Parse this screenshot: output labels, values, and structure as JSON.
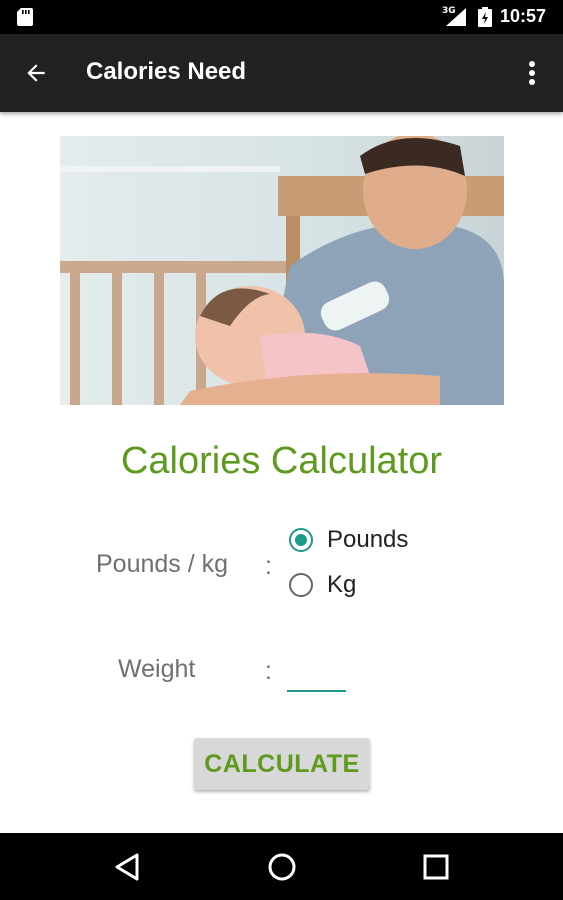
{
  "status_bar": {
    "network": "3G",
    "time": "10:57",
    "icons": [
      "sd-card-icon",
      "signal-icon",
      "battery-icon"
    ]
  },
  "app_bar": {
    "title": "Calories Need",
    "back_icon": "arrow-left-icon",
    "menu_icon": "more-vert-icon"
  },
  "hero": {
    "image": "photo-father-feeding-baby-bottle"
  },
  "calculator": {
    "heading": "Calories Calculator",
    "unit_label": "Pounds / kg",
    "unit_colon": ":",
    "unit_options": [
      {
        "label": "Pounds",
        "checked": true
      },
      {
        "label": "Kg",
        "checked": false
      }
    ],
    "weight_label": "Weight",
    "weight_colon": ":",
    "weight_value": "",
    "weight_placeholder": "",
    "button_label": "CALCULATE"
  },
  "colors": {
    "accent_green": "#5d9a1e",
    "teal": "#1e9a8a",
    "app_bar_bg": "#212121",
    "button_bg": "#d8d8d8"
  },
  "nav_bar": {
    "icons": [
      "nav-back-icon",
      "nav-home-icon",
      "nav-recents-icon"
    ]
  }
}
